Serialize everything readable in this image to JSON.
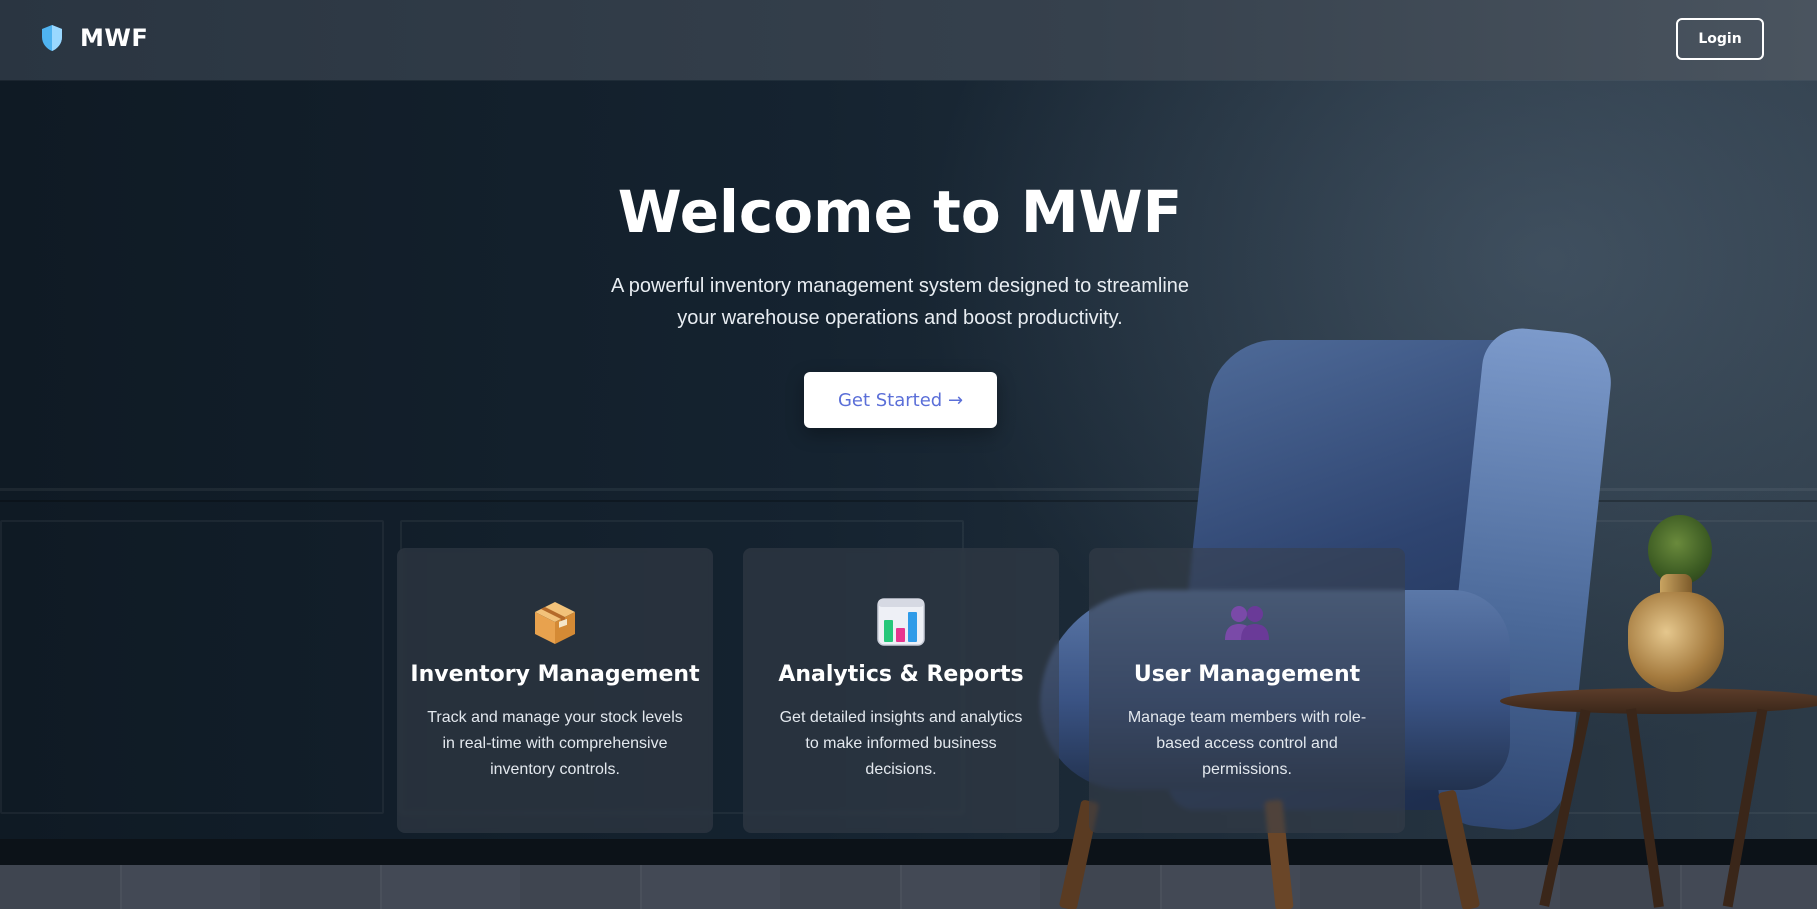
{
  "header": {
    "brand_name": "MWF",
    "brand_icon": "shield-icon",
    "login_label": "Login"
  },
  "hero": {
    "title": "Welcome to MWF",
    "subtitle": "A powerful inventory management system designed to streamline your warehouse operations and boost productivity.",
    "cta_label": "Get Started →"
  },
  "features": [
    {
      "icon": "package-icon",
      "title": "Inventory Management",
      "description": "Track and manage your stock levels in real-time with comprehensive inventory controls."
    },
    {
      "icon": "bar-chart-icon",
      "title": "Analytics & Reports",
      "description": "Get detailed insights and analytics to make informed business decisions."
    },
    {
      "icon": "users-icon",
      "title": "User Management",
      "description": "Manage team members with role-based access control and permissions."
    }
  ],
  "colors": {
    "accent": "#5b6fd8",
    "brand_icon": "#4fb3f0",
    "background": "#121d27"
  }
}
